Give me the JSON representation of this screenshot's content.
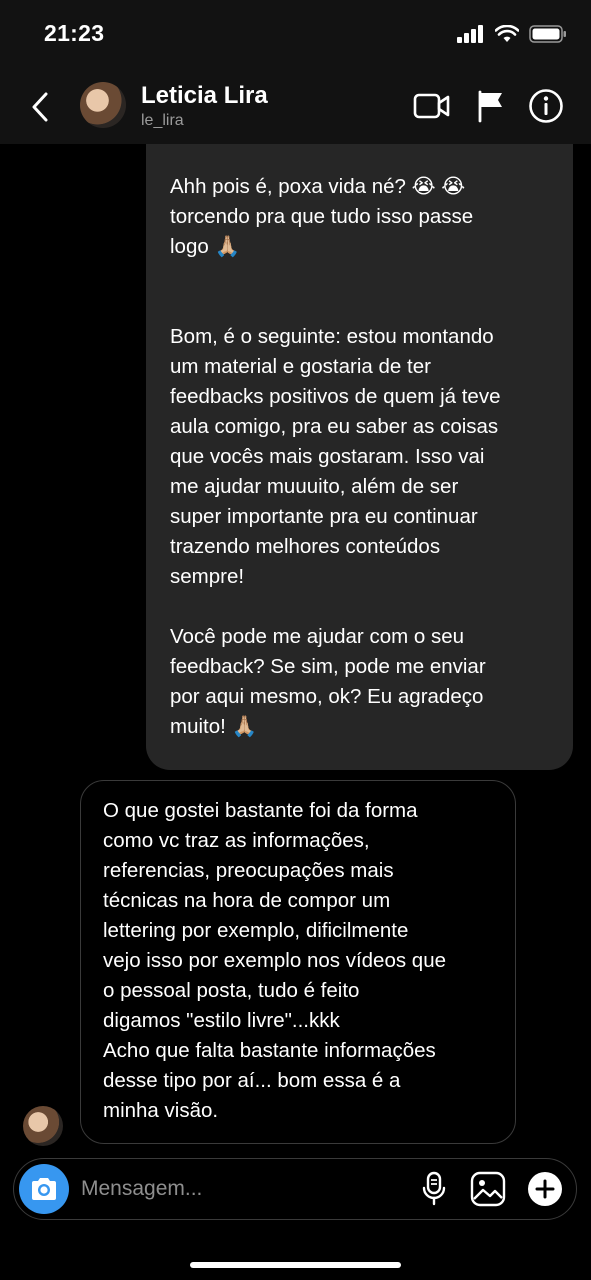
{
  "status_bar": {
    "time": "21:23"
  },
  "header": {
    "name": "Leticia Lira",
    "username": "le_lira",
    "icons": [
      "back-icon",
      "video-call-icon",
      "flag-icon",
      "info-icon"
    ]
  },
  "messages": {
    "outgoing": "Ahh pois é, poxa vida né? 😭 😭\ntorcendo pra que tudo isso passe\nlogo 🙏🏼\n\n\nBom, é o seguinte: estou montando\num material e gostaria de ter\nfeedbacks positivos de quem já teve\naula comigo, pra eu saber as coisas\nque vocês mais gostaram. Isso vai\nme ajudar muuuito, além de ser\nsuper importante pra eu continuar\ntrazendo melhores conteúdos\nsempre!\n\nVocê pode me ajudar com o seu\nfeedback? Se sim, pode me enviar\npor aqui mesmo, ok? Eu agradeço\nmuito! 🙏🏼",
    "incoming": "O que gostei bastante foi da forma\ncomo vc traz as informações,\nreferencias, preocupações mais\ntécnicas na hora de compor um\nlettering por exemplo, dificilmente\nvejo isso por exemplo nos vídeos que\no pessoal posta, tudo é feito\ndigamos \"estilo livre\"...kkk\nAcho que falta bastante informações\ndesse tipo por aí... bom essa é a\nminha visão."
  },
  "composer": {
    "placeholder": "Mensagem...",
    "icons": [
      "camera-icon",
      "microphone-icon",
      "gallery-icon",
      "add-icon"
    ]
  },
  "colors": {
    "accent": "#3797f0",
    "bubble_out": "#262626",
    "background": "#000000",
    "bar": "#121212"
  }
}
